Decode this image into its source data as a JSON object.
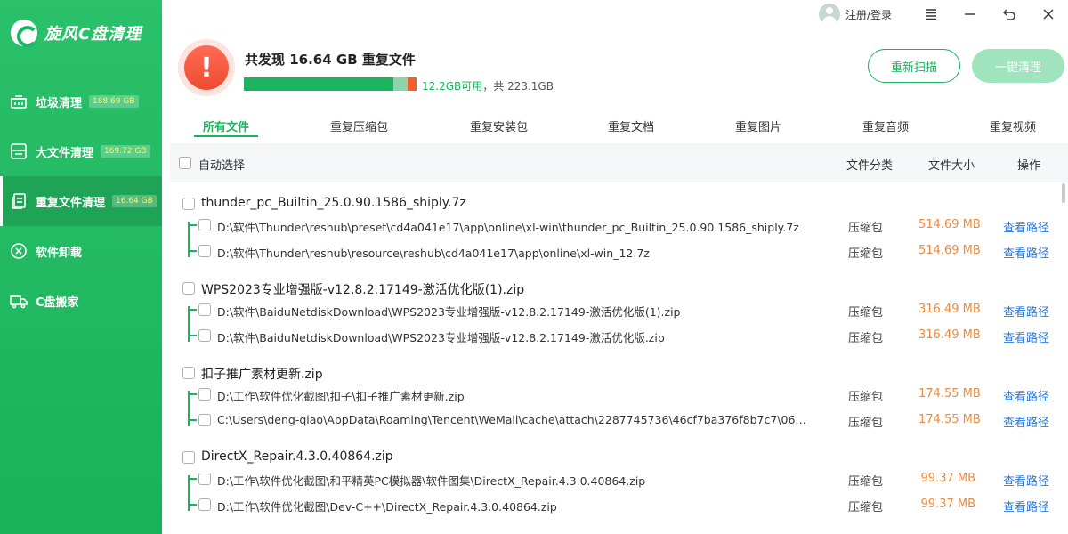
{
  "app": {
    "name": "旋风C盘清理"
  },
  "sidebar": {
    "items": [
      {
        "label": "垃圾清理",
        "badge": "188.69 GB",
        "icon": "trash-icon"
      },
      {
        "label": "大文件清理",
        "badge": "169.72 GB",
        "icon": "bigfile-icon"
      },
      {
        "label": "重复文件清理",
        "badge": "16.64 GB",
        "icon": "duplicate-icon",
        "active": true
      },
      {
        "label": "软件卸载",
        "badge": "",
        "icon": "uninstall-icon"
      },
      {
        "label": "C盘搬家",
        "badge": "",
        "icon": "truck-icon"
      }
    ]
  },
  "topbar": {
    "login_label": "注册/登录"
  },
  "summary": {
    "title": "共发现 16.64 GB 重复文件",
    "disk_free": "12.2GB可用",
    "disk_total": "，共 223.1GB",
    "disk_used_fraction": 0.85,
    "rescan_label": "重新扫描",
    "clean_label": "一键清理"
  },
  "tabs": [
    {
      "label": "所有文件",
      "active": true
    },
    {
      "label": "重复压缩包"
    },
    {
      "label": "重复安装包"
    },
    {
      "label": "重复文档"
    },
    {
      "label": "重复图片"
    },
    {
      "label": "重复音频"
    },
    {
      "label": "重复视频"
    }
  ],
  "table": {
    "auto_select_label": "自动选择",
    "col_category": "文件分类",
    "col_size": "文件大小",
    "col_action": "操作",
    "view_path_label": "查看路径",
    "groups": [
      {
        "name": "thunder_pc_Builtin_25.0.90.1586_shiply.7z",
        "files": [
          {
            "path": "D:\\软件\\Thunder\\reshub\\preset\\cd4a041e17\\app\\online\\xl-win\\thunder_pc_Builtin_25.0.90.1586_shiply.7z",
            "category": "压缩包",
            "size": "514.69 MB"
          },
          {
            "path": "D:\\软件\\Thunder\\reshub\\resource\\reshub\\cd4a041e17\\app\\online\\xl-win_12.7z",
            "category": "压缩包",
            "size": "514.69 MB"
          }
        ]
      },
      {
        "name": "WPS2023专业增强版-v12.8.2.17149-激活优化版(1).zip",
        "files": [
          {
            "path": "D:\\软件\\BaiduNetdiskDownload\\WPS2023专业增强版-v12.8.2.17149-激活优化版(1).zip",
            "category": "压缩包",
            "size": "316.49 MB"
          },
          {
            "path": "D:\\软件\\BaiduNetdiskDownload\\WPS2023专业增强版-v12.8.2.17149-激活优化版.zip",
            "category": "压缩包",
            "size": "316.49 MB"
          }
        ]
      },
      {
        "name": "扣子推广素材更新.zip",
        "files": [
          {
            "path": "D:\\工作\\软件优化截图\\扣子\\扣子推广素材更新.zip",
            "category": "压缩包",
            "size": "174.55 MB"
          },
          {
            "path": "C:\\Users\\deng-qiao\\AppData\\Roaming\\Tencent\\WeMail\\cache\\attach\\2287745736\\46cf7ba376f8b7c7\\06…",
            "category": "压缩包",
            "size": "174.55 MB"
          }
        ]
      },
      {
        "name": "DirectX_Repair.4.3.0.40864.zip",
        "files": [
          {
            "path": "D:\\工作\\软件优化截图\\和平精英PC模拟器\\软件图集\\DirectX_Repair.4.3.0.40864.zip",
            "category": "压缩包",
            "size": "99.37 MB"
          },
          {
            "path": "D:\\工作\\软件优化截图\\Dev-C++\\DirectX_Repair.4.3.0.40864.zip",
            "category": "压缩包",
            "size": "99.37 MB"
          }
        ]
      }
    ]
  },
  "colors": {
    "accent": "#1bb35e",
    "size": "#ef8a3c",
    "link": "#2b79d6",
    "alert": "#ee4b32"
  }
}
